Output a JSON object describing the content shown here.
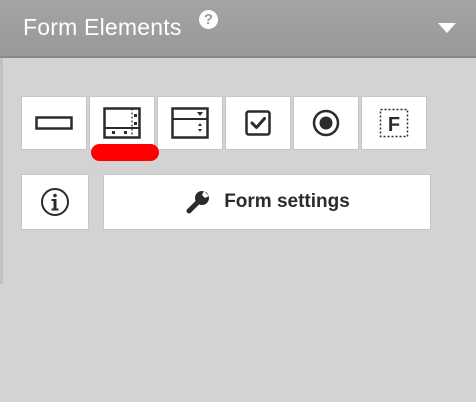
{
  "panel": {
    "title": "Form Elements",
    "help_icon": "question-circle-icon",
    "collapse_icon": "caret-down-icon"
  },
  "toolbar": {
    "tools": [
      {
        "name": "text-field-tool",
        "icon": "text-field-icon"
      },
      {
        "name": "textarea-tool",
        "icon": "textarea-icon"
      },
      {
        "name": "select-tool",
        "icon": "select-dropdown-icon"
      },
      {
        "name": "checkbox-tool",
        "icon": "checkbox-icon"
      },
      {
        "name": "radio-tool",
        "icon": "radio-button-icon"
      },
      {
        "name": "file-tool",
        "icon": "file-upload-icon"
      }
    ],
    "highlight_color": "#ff0000"
  },
  "actions": {
    "info_icon": "info-circle-icon",
    "settings_label": "Form settings",
    "settings_icon": "wrench-icon",
    "file_icon_letter": "F"
  },
  "colors": {
    "header_bg": "#a0a0a0",
    "panel_bg": "#d3d3d3",
    "button_bg": "#ffffff",
    "icon_color": "#2b2b2b"
  }
}
